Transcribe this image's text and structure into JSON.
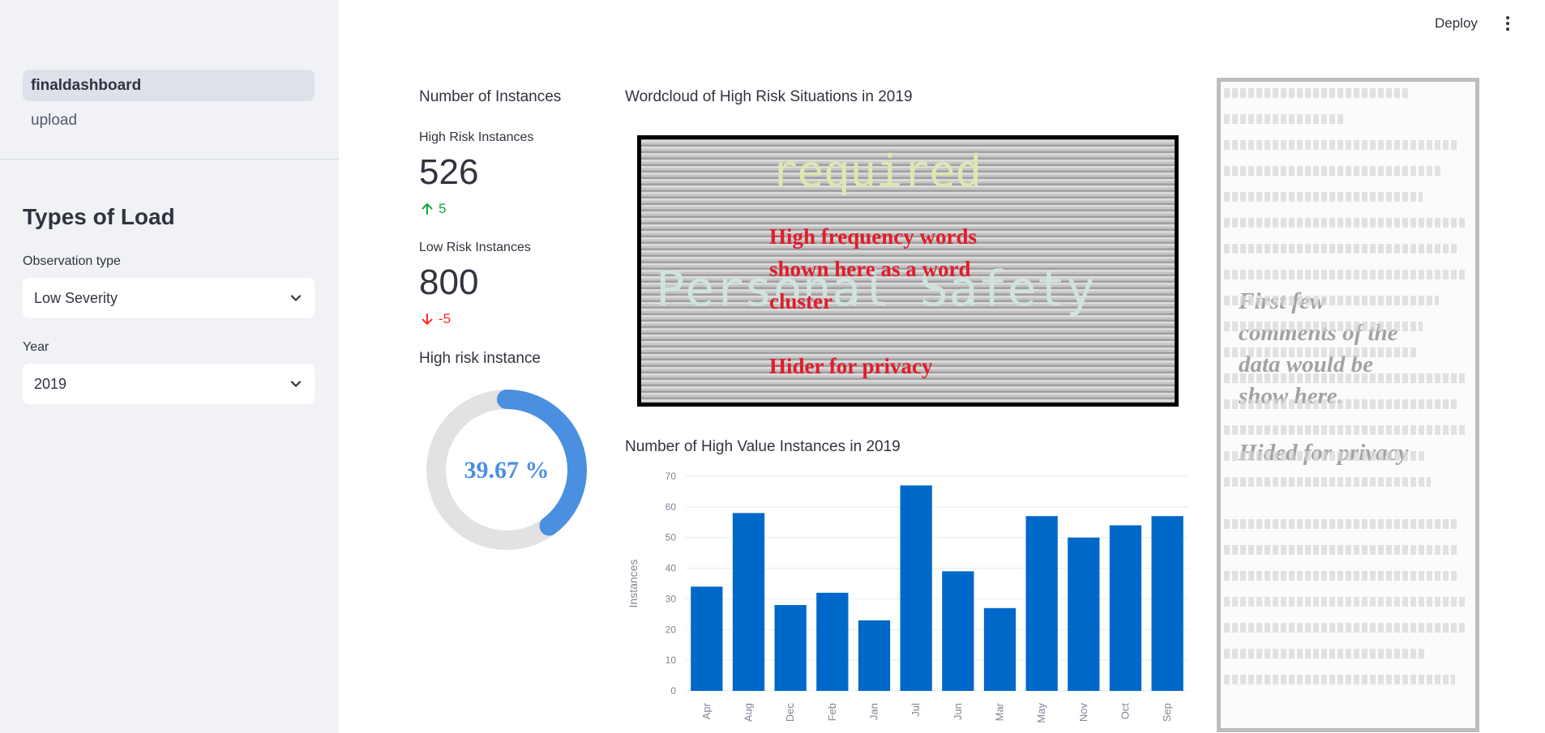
{
  "sidebar": {
    "nav": [
      {
        "label": "finaldashboard",
        "active": true
      },
      {
        "label": "upload",
        "active": false
      }
    ],
    "title": "Types of Load",
    "observation_type": {
      "label": "Observation type",
      "value": "Low Severity"
    },
    "year": {
      "label": "Year",
      "value": "2019"
    }
  },
  "header": {
    "deploy": "Deploy",
    "menu_icon": "kebab-menu-icon"
  },
  "metrics": {
    "title": "Number of Instances",
    "high": {
      "label": "High Risk Instances",
      "value": "526",
      "delta": "5",
      "direction": "up"
    },
    "low": {
      "label": "Low Risk Instances",
      "value": "800",
      "delta": "-5",
      "direction": "down"
    },
    "donut": {
      "title": "High risk instance",
      "label": "39.67 %",
      "fraction": 0.3967,
      "color": "#4a8fe0",
      "track_color": "#e2e2e2"
    }
  },
  "wordcloud": {
    "title": "Wordcloud of High Risk Situations in 2019",
    "words": [
      "required",
      "Personal Safety"
    ],
    "overlay_lines": [
      "High frequency words",
      "shown here as a word",
      "cluster"
    ],
    "overlay_privacy": "Hider for privacy"
  },
  "comments": {
    "overlay_lines": [
      "First few",
      "comments of the",
      "data would be",
      "show here."
    ],
    "overlay_privacy": "Hided for privacy"
  },
  "chart_data": {
    "type": "bar",
    "title": "Number of High Value Instances in 2019",
    "xlabel": "",
    "ylabel": "Instances",
    "categories": [
      "Apr",
      "Aug",
      "Dec",
      "Feb",
      "Jan",
      "Jul",
      "Jun",
      "Mar",
      "May",
      "Nov",
      "Oct",
      "Sep"
    ],
    "values": [
      34,
      58,
      28,
      32,
      23,
      67,
      39,
      27,
      57,
      50,
      54,
      57
    ],
    "ylim": [
      0,
      70
    ],
    "yticks": [
      0,
      10,
      20,
      30,
      40,
      50,
      60,
      70
    ],
    "grid": true,
    "color": "#0068c9"
  }
}
